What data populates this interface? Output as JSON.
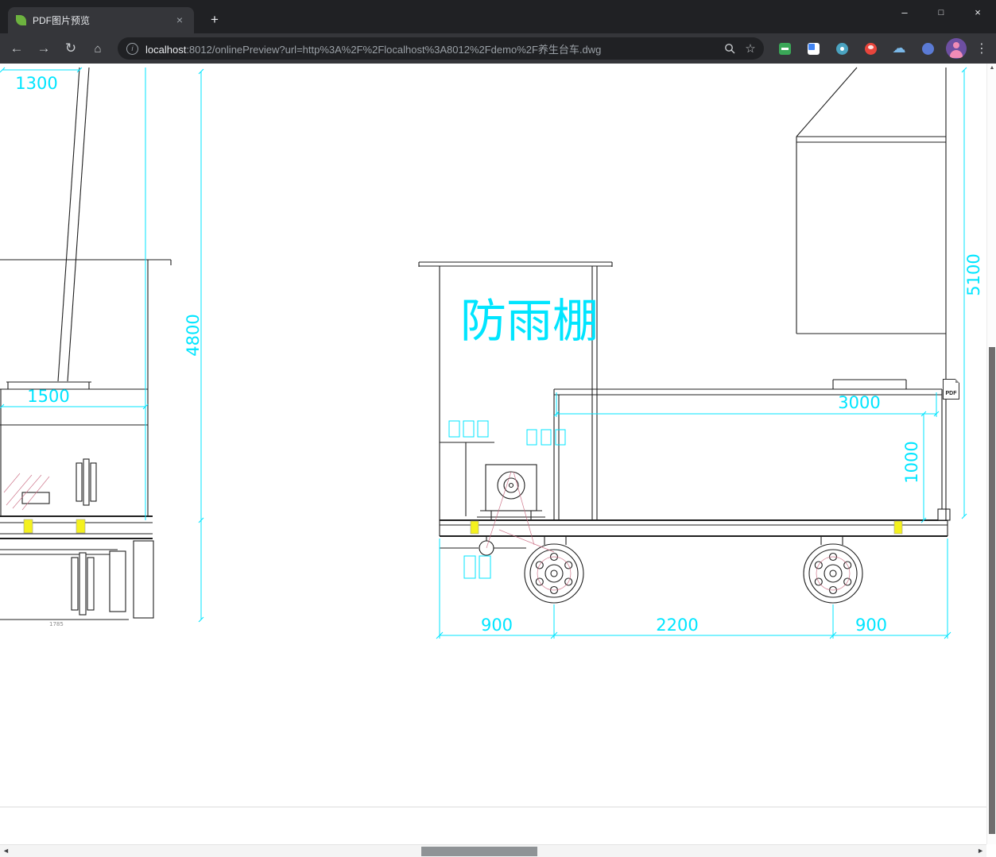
{
  "theme": {
    "frame": "#202124",
    "tab_bg": "#35363a",
    "toolbar_bg": "#35363a",
    "omnibox_bg": "#202124",
    "text_light": "#e8eaed",
    "text_muted": "#9aa0a6",
    "favicon_green": "#6db33f",
    "ext1": "#3aa757",
    "ext2_blue": "#4285f4",
    "ext3": "#4aa3c0",
    "ext4": "#e8453c",
    "ext5_cloud": "#7ab8e8",
    "ext6": "#5b7bd5",
    "avatar_bg": "#6d4fa1",
    "avatar_fg": "#f08bb6",
    "scroll_thumb": "#6e6e6e",
    "scroll_track": "#f4f4f4"
  },
  "window": {
    "tab_title": "PDF图片预览",
    "icons": {
      "minimize": "–",
      "maximize": "□",
      "close": "×",
      "tab_close": "×",
      "new_tab": "+"
    }
  },
  "toolbar": {
    "icons": {
      "back": "←",
      "forward": "→",
      "reload": "↻",
      "home": "⌂",
      "info": "i",
      "star": "☆",
      "menu": "⋮",
      "cloud": "☁",
      "scroll_up": "▲",
      "scroll_left": "◄",
      "scroll_right": "►"
    },
    "url": {
      "host": "localhost",
      "rest": ":8012/onlinePreview?url=http%3A%2F%2Flocalhost%3A8012%2Fdemo%2F养生台车.dwg"
    }
  },
  "drawing": {
    "shelter_label": "防雨棚",
    "pdf_badge": "PDF",
    "dims": {
      "left_top_width": "1300",
      "left_height": "4800",
      "left_width": "1500",
      "left_detail": "1785",
      "right_height": "5100",
      "deck_length": "3000",
      "deck_height": "1000",
      "front_overhang": "900",
      "wheel_base": "2200",
      "rear_overhang": "900"
    },
    "colors": {
      "dim_cyan": "#00e5ff",
      "line_dark": "#1f1f1f",
      "center_red": "#c9687f",
      "mark_yellow": "#f4f11e"
    }
  }
}
